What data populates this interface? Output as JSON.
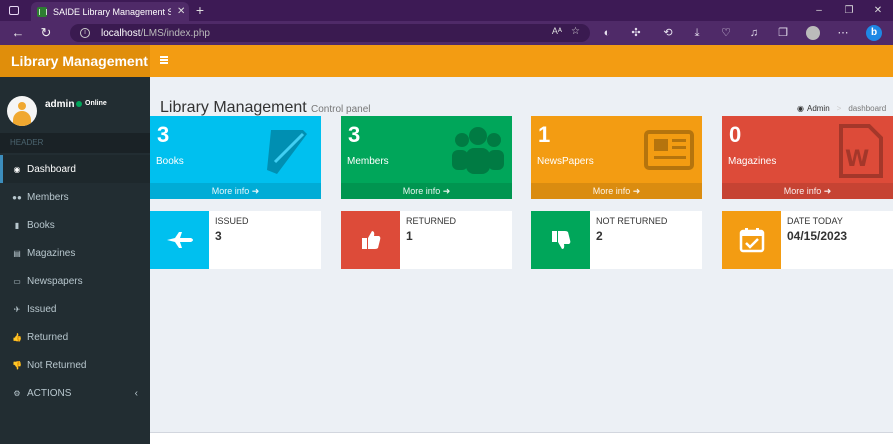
{
  "browser": {
    "tab_title": "SAIDE Library Management Syste",
    "tab_close": "✕",
    "new_tab": "+",
    "url_host": "localhost",
    "url_path": "/LMS/index.php",
    "reader": "Aᴬ",
    "controls": {
      "minimize": "–",
      "restore": "❐",
      "close": "✕"
    }
  },
  "app": {
    "logo": "Library Management"
  },
  "user": {
    "name": "admin",
    "status": "Online"
  },
  "sidebar": {
    "header": "HEADER",
    "items": [
      {
        "label": "Dashboard",
        "icon": "dashboard-icon",
        "glyph": "◉"
      },
      {
        "label": "Members",
        "icon": "users-icon",
        "glyph": "●●"
      },
      {
        "label": "Books",
        "icon": "book-icon",
        "glyph": "▮"
      },
      {
        "label": "Magazines",
        "icon": "file-icon",
        "glyph": "▤"
      },
      {
        "label": "Newspapers",
        "icon": "newspaper-icon",
        "glyph": "▭"
      },
      {
        "label": "Issued",
        "icon": "plane-icon",
        "glyph": "✈"
      },
      {
        "label": "Returned",
        "icon": "thumbs-up-icon",
        "glyph": "👍"
      },
      {
        "label": "Not Returned",
        "icon": "thumbs-down-icon",
        "glyph": "👎"
      },
      {
        "label": "ACTIONS",
        "icon": "cogs-icon",
        "glyph": "⚙",
        "chevron": "‹"
      }
    ]
  },
  "page": {
    "title": "Library Management",
    "subtitle": "Control panel",
    "breadcrumb": {
      "home": "Admin",
      "separator": ">",
      "current": "dashboard"
    }
  },
  "stat_boxes": [
    {
      "count": "3",
      "label": "Books",
      "more": "More info ➜",
      "color": "#00c0ef",
      "icon": "book-icon"
    },
    {
      "count": "3",
      "label": "Members",
      "more": "More info ➜",
      "color": "#00a65a",
      "icon": "users-icon"
    },
    {
      "count": "1",
      "label": "NewsPapers",
      "more": "More info ➜",
      "color": "#f39c12",
      "icon": "newspaper-icon"
    },
    {
      "count": "0",
      "label": "Magazines",
      "more": "More info ➜",
      "color": "#dd4b39",
      "icon": "word-file-icon"
    }
  ],
  "info_boxes": [
    {
      "label": "ISSUED",
      "value": "3",
      "color": "#00c0ef",
      "icon": "plane-icon"
    },
    {
      "label": "RETURNED",
      "value": "1",
      "color": "#dd4b39",
      "icon": "thumbs-up-icon"
    },
    {
      "label": "NOT RETURNED",
      "value": "2",
      "color": "#00a65a",
      "icon": "thumbs-down-icon"
    },
    {
      "label": "DATE TODAY",
      "value": "04/15/2023",
      "color": "#f39c12",
      "icon": "calendar-check-icon"
    }
  ]
}
